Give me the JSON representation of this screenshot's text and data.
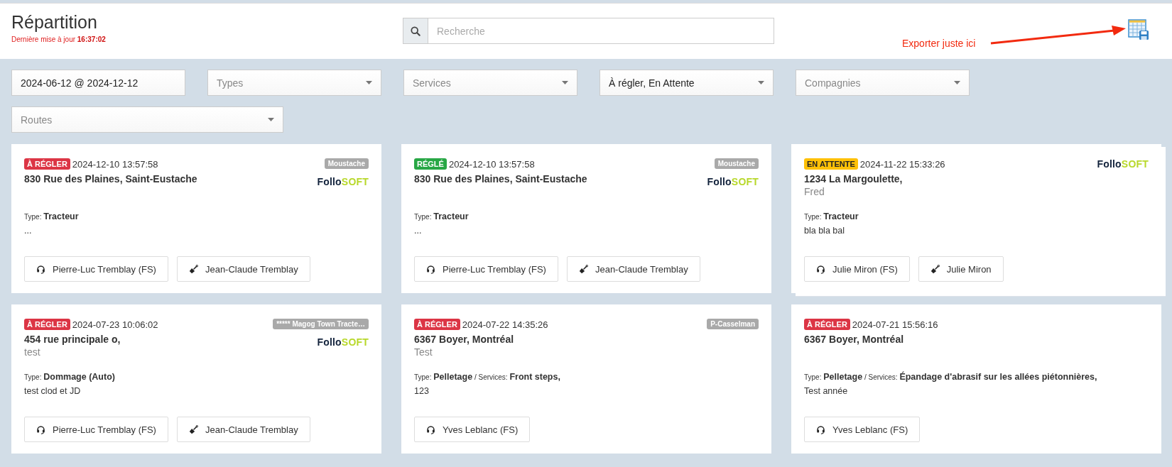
{
  "header": {
    "title": "Répartition",
    "updated": "Dernière mise à jour **16:37:02**",
    "search": {
      "placeholder": "Recherche"
    },
    "annotation": "Exporter juste ici"
  },
  "filters": [
    {
      "kind": "date",
      "value": "2024-06-12 @ 2024-12-12"
    },
    {
      "kind": "select",
      "placeholder": "Types"
    },
    {
      "kind": "select",
      "placeholder": "Services"
    },
    {
      "kind": "select",
      "value": "À régler, En Attente"
    },
    {
      "kind": "select",
      "placeholder": "Compagnies"
    },
    {
      "kind": "select",
      "placeholder": "Routes",
      "wide": true
    }
  ],
  "cards": [
    {
      "status": {
        "kind": "pending",
        "label": "À RÉGLER"
      },
      "datetime": "2024-12-10 13:57:58",
      "tag": "Moustache",
      "logo": {
        "first": "Follo",
        "second": "SOFT"
      },
      "address": "830 Rue des Plaines, Saint-Eustache",
      "details": "Type: **Tracteur**",
      "note": "...",
      "stacked": false,
      "people": [
        {
          "kind": "dispatcher",
          "name": "Pierre-Luc Tremblay (FS)"
        },
        {
          "kind": "worker",
          "name": "Jean-Claude Tremblay"
        }
      ]
    },
    {
      "status": {
        "kind": "settled",
        "label": "RÉGLÉ"
      },
      "datetime": "2024-12-10 13:57:58",
      "tag": "Moustache",
      "logo": {
        "first": "Follo",
        "second": "SOFT"
      },
      "address": "830 Rue des Plaines, Saint-Eustache",
      "details": "Type: **Tracteur**",
      "note": "...",
      "stacked": false,
      "people": [
        {
          "kind": "dispatcher",
          "name": "Pierre-Luc Tremblay (FS)"
        },
        {
          "kind": "worker",
          "name": "Jean-Claude Tremblay"
        }
      ]
    },
    {
      "status": {
        "kind": "waiting",
        "label": "EN ATTENTE"
      },
      "datetime": "2024-11-22 15:33:26",
      "logo": {
        "first": "Follo",
        "second": "SOFT"
      },
      "address": "1234 La Margoulette,",
      "subtitle": "Fred",
      "details": "Type: **Tracteur**",
      "note": "bla bla bal",
      "stacked": true,
      "people": [
        {
          "kind": "dispatcher",
          "name": "Julie Miron (FS)"
        },
        {
          "kind": "worker",
          "name": "Julie Miron"
        }
      ]
    },
    {
      "status": {
        "kind": "pending",
        "label": "À RÉGLER"
      },
      "datetime": "2024-07-23 10:06:02",
      "tag": "***** Magog Town Tracte…",
      "logo": {
        "first": "Follo",
        "second": "SOFT"
      },
      "address": "454 rue principale o,",
      "subtitle": "test",
      "details": "Type: **Dommage (Auto)**",
      "note": "test clod et JD",
      "stacked": false,
      "people": [
        {
          "kind": "dispatcher",
          "name": "Pierre-Luc Tremblay (FS)"
        },
        {
          "kind": "worker",
          "name": "Jean-Claude Tremblay"
        }
      ]
    },
    {
      "status": {
        "kind": "pending",
        "label": "À RÉGLER"
      },
      "datetime": "2024-07-22 14:35:26",
      "tag": "P-Casselman",
      "address": "6367 Boyer, Montréal",
      "subtitle": "Test",
      "details": "Type: **Pelletage** / Services: **Front steps,**",
      "note": "123",
      "stacked": false,
      "people": [
        {
          "kind": "dispatcher",
          "name": "Yves Leblanc (FS)"
        }
      ]
    },
    {
      "status": {
        "kind": "pending",
        "label": "À RÉGLER"
      },
      "datetime": "2024-07-21 15:56:16",
      "address": "6367 Boyer, Montréal",
      "details": "Type: **Pelletage** / Services: **Épandage d'abrasif sur les allées piétonnières,**",
      "note": "Test année",
      "stacked": false,
      "people": [
        {
          "kind": "dispatcher",
          "name": "Yves Leblanc (FS)"
        }
      ]
    }
  ]
}
